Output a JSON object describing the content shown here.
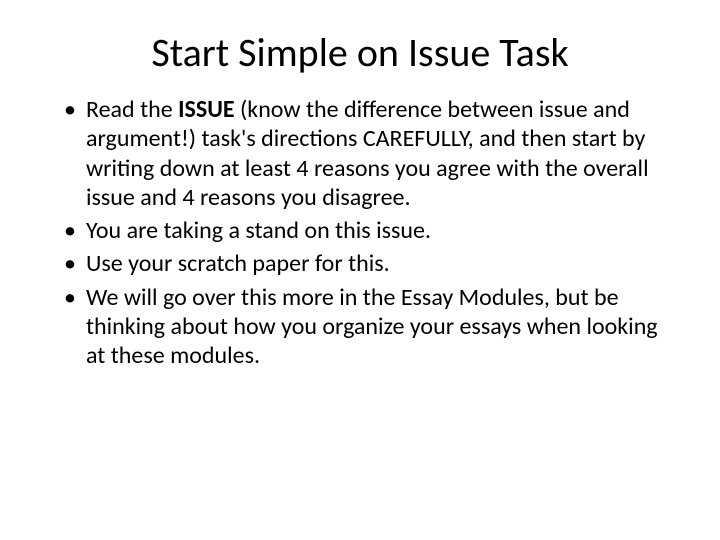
{
  "title": "Start Simple on Issue Task",
  "bullets": [
    {
      "pre": "Read the ",
      "bold": "ISSUE",
      "post": " (know the difference between issue and argument!) task's directions CAREFULLY, and then start by writing down at least 4 reasons you agree with the overall issue and 4 reasons you disagree."
    },
    {
      "pre": "You are taking a stand on this issue.",
      "bold": "",
      "post": ""
    },
    {
      "pre": "Use your scratch paper for this.",
      "bold": "",
      "post": ""
    },
    {
      "pre": "We will go over this more in the Essay Modules, but be thinking about how you organize your essays when looking at these modules.",
      "bold": "",
      "post": ""
    }
  ]
}
